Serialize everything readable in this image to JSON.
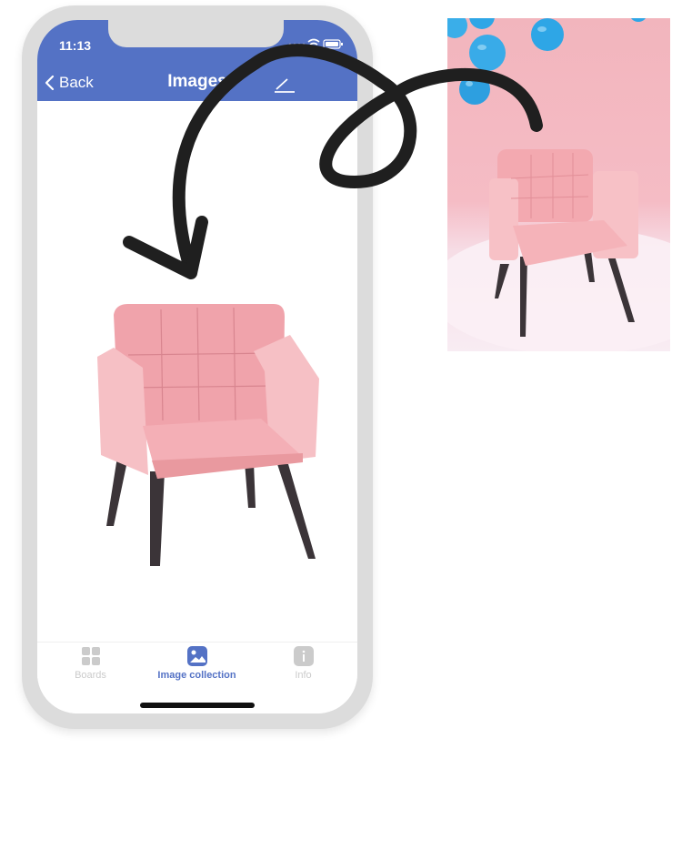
{
  "status_bar": {
    "time": "11:13"
  },
  "header": {
    "back_label": "Back",
    "title": "Images"
  },
  "tabs": [
    {
      "label": "Boards",
      "icon": "grid-icon",
      "active": false
    },
    {
      "label": "Image collection",
      "icon": "image-icon",
      "active": true
    },
    {
      "label": "Info",
      "icon": "info-icon",
      "active": false
    }
  ],
  "colors": {
    "accent": "#5472c5",
    "inactive_tab": "#cbcbcb",
    "chair_pink": "#f3a9b0",
    "chair_leg": "#3b3438",
    "balloon_blue": "#2ea6e6"
  }
}
